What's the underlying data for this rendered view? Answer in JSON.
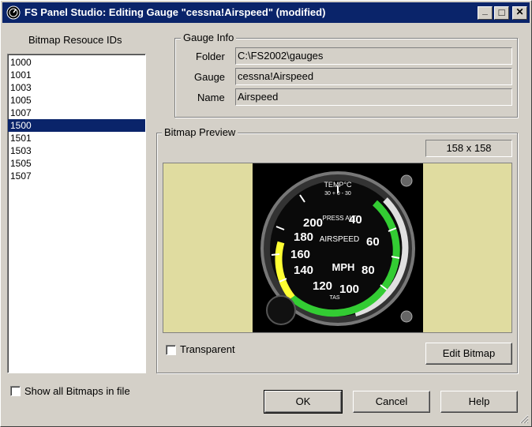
{
  "window": {
    "title": "FS Panel Studio: Editing Gauge \"cessna!Airspeed\" (modified)",
    "minimize_glyph": "_",
    "maximize_glyph": "□",
    "close_glyph": "✕"
  },
  "bitmap_list": {
    "header": "Bitmap Resouce IDs",
    "items": [
      "1000",
      "1001",
      "1003",
      "1005",
      "1007",
      "1500",
      "1501",
      "1503",
      "1505",
      "1507"
    ],
    "selected": "1500"
  },
  "gauge_info": {
    "group_title": "Gauge Info",
    "folder_label": "Folder",
    "folder_value": "C:\\FS2002\\gauges",
    "gauge_label": "Gauge",
    "gauge_value": "cessna!Airspeed",
    "name_label": "Name",
    "name_value": "Airspeed"
  },
  "preview": {
    "group_title": "Bitmap Preview",
    "size_text": "158 x 158",
    "transparent_label": "Transparent",
    "transparent_checked": false,
    "edit_button": "Edit Bitmap",
    "gauge_labels": {
      "temp": "TEMP°C",
      "temp_scale": "30 + 0 - 30",
      "press_alt": "PRESS ALT",
      "airspeed": "AIRSPEED",
      "mph": "MPH",
      "tas": "TAS",
      "numbers": [
        "200",
        "180",
        "160",
        "140",
        "120",
        "100",
        "80",
        "60",
        "40"
      ]
    }
  },
  "show_all": {
    "label": "Show all Bitmaps in file",
    "checked": false
  },
  "buttons": {
    "ok": "OK",
    "cancel": "Cancel",
    "help": "Help"
  },
  "colors": {
    "titlebar": "#0a246a",
    "preview_background": "#e0dca0",
    "green_arc": "#33cc33",
    "yellow_arc": "#ffff33",
    "white_arc": "#e0e0e0"
  }
}
